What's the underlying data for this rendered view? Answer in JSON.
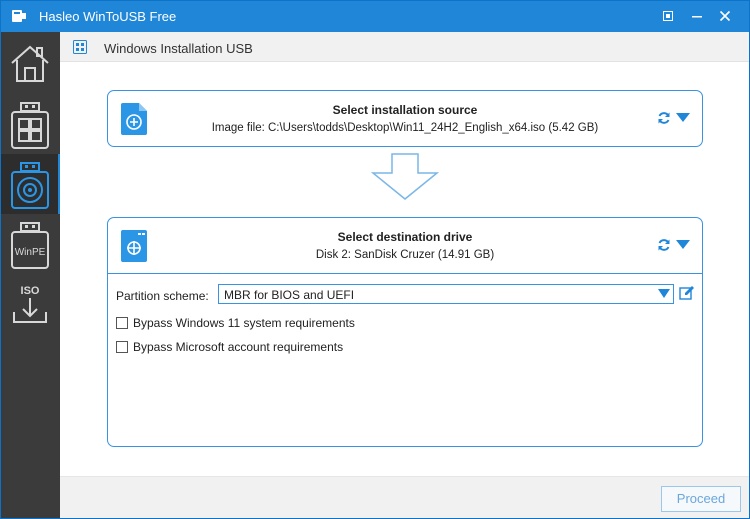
{
  "window": {
    "title": "Hasleo WinToUSB Free"
  },
  "sidebar": {
    "items": [
      {
        "name": "home",
        "label": ""
      },
      {
        "name": "windows-to-go",
        "label": ""
      },
      {
        "name": "windows-installation-usb",
        "label": ""
      },
      {
        "name": "winpe",
        "label": "WinPE"
      },
      {
        "name": "iso",
        "label": "ISO"
      }
    ]
  },
  "header": {
    "title": "Windows Installation USB"
  },
  "source": {
    "title": "Select installation source",
    "subtitle": "Image file: C:\\Users\\todds\\Desktop\\Win11_24H2_English_x64.iso (5.42 GB)"
  },
  "destination": {
    "title": "Select destination drive",
    "subtitle": "Disk 2: SanDisk Cruzer (14.91 GB)",
    "partition_label": "Partition scheme:",
    "partition_value": "MBR for BIOS and UEFI",
    "options": [
      {
        "label": "Bypass Windows 11 system requirements",
        "checked": false
      },
      {
        "label": "Bypass Microsoft account requirements",
        "checked": false
      }
    ]
  },
  "footer": {
    "proceed_label": "Proceed"
  },
  "colors": {
    "accent": "#1f86d8",
    "sidebar": "#3b3b3b",
    "card_border": "#3a93e0"
  }
}
